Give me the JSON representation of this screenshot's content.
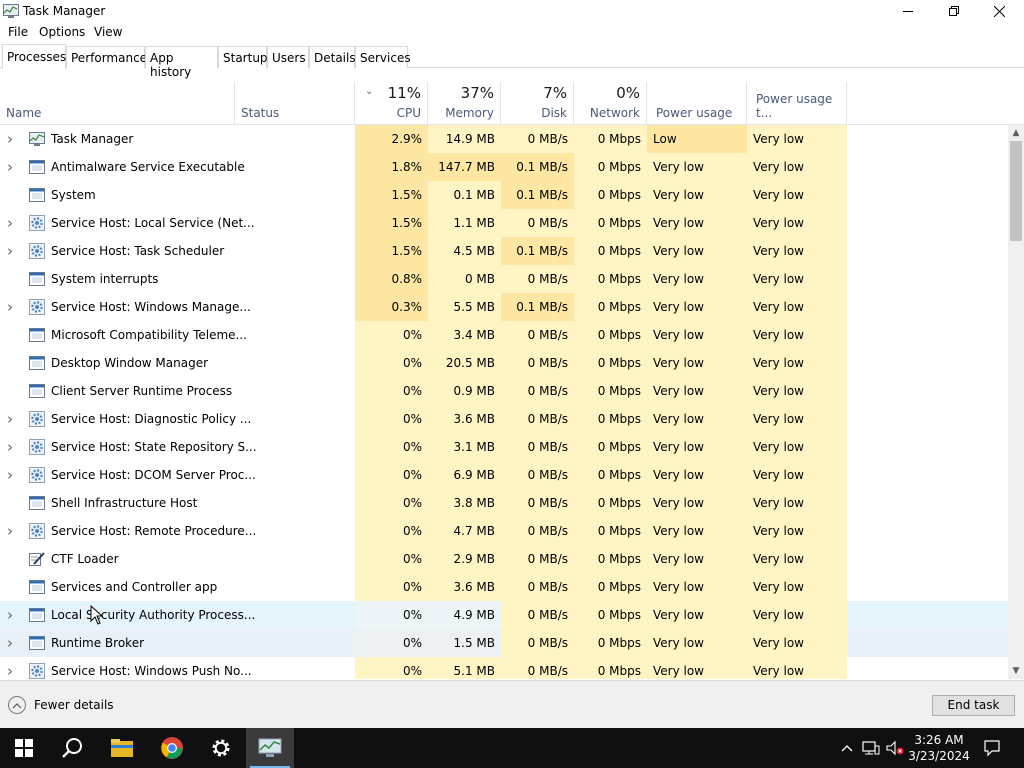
{
  "window": {
    "title": "Task Manager"
  },
  "menu": [
    "File",
    "Options",
    "View"
  ],
  "tabs": [
    "Processes",
    "Performance",
    "App history",
    "Startup",
    "Users",
    "Details",
    "Services"
  ],
  "columns": {
    "name": "Name",
    "status": "Status",
    "cpu": {
      "pct": "11%",
      "label": "CPU"
    },
    "memory": {
      "pct": "37%",
      "label": "Memory"
    },
    "disk": {
      "pct": "7%",
      "label": "Disk"
    },
    "network": {
      "pct": "0%",
      "label": "Network"
    },
    "power": "Power usage",
    "power_trend": "Power usage t..."
  },
  "processes": [
    {
      "name": "Task Manager",
      "expandable": true,
      "icon": "taskmgr-icon",
      "cpu": "2.9%",
      "memory": "14.9 MB",
      "disk": "0 MB/s",
      "network": "0 Mbps",
      "power": "Low",
      "power_trend": "Very low"
    },
    {
      "name": "Antimalware Service Executable",
      "expandable": true,
      "icon": "window-icon",
      "cpu": "1.8%",
      "memory": "147.7 MB",
      "disk": "0.1 MB/s",
      "network": "0 Mbps",
      "power": "Very low",
      "power_trend": "Very low"
    },
    {
      "name": "System",
      "expandable": false,
      "icon": "window-icon",
      "cpu": "1.5%",
      "memory": "0.1 MB",
      "disk": "0.1 MB/s",
      "network": "0 Mbps",
      "power": "Very low",
      "power_trend": "Very low"
    },
    {
      "name": "Service Host: Local Service (Net...",
      "expandable": true,
      "icon": "gear-icon",
      "cpu": "1.5%",
      "memory": "1.1 MB",
      "disk": "0 MB/s",
      "network": "0 Mbps",
      "power": "Very low",
      "power_trend": "Very low"
    },
    {
      "name": "Service Host: Task Scheduler",
      "expandable": true,
      "icon": "gear-icon",
      "cpu": "1.5%",
      "memory": "4.5 MB",
      "disk": "0.1 MB/s",
      "network": "0 Mbps",
      "power": "Very low",
      "power_trend": "Very low"
    },
    {
      "name": "System interrupts",
      "expandable": false,
      "icon": "window-icon",
      "cpu": "0.8%",
      "memory": "0 MB",
      "disk": "0 MB/s",
      "network": "0 Mbps",
      "power": "Very low",
      "power_trend": "Very low"
    },
    {
      "name": "Service Host: Windows Manage...",
      "expandable": true,
      "icon": "gear-icon",
      "cpu": "0.3%",
      "memory": "5.5 MB",
      "disk": "0.1 MB/s",
      "network": "0 Mbps",
      "power": "Very low",
      "power_trend": "Very low"
    },
    {
      "name": "Microsoft Compatibility Teleme...",
      "expandable": false,
      "icon": "window-icon",
      "cpu": "0%",
      "memory": "3.4 MB",
      "disk": "0 MB/s",
      "network": "0 Mbps",
      "power": "Very low",
      "power_trend": "Very low"
    },
    {
      "name": "Desktop Window Manager",
      "expandable": false,
      "icon": "window-icon",
      "cpu": "0%",
      "memory": "20.5 MB",
      "disk": "0 MB/s",
      "network": "0 Mbps",
      "power": "Very low",
      "power_trend": "Very low"
    },
    {
      "name": "Client Server Runtime Process",
      "expandable": false,
      "icon": "window-icon",
      "cpu": "0%",
      "memory": "0.9 MB",
      "disk": "0 MB/s",
      "network": "0 Mbps",
      "power": "Very low",
      "power_trend": "Very low"
    },
    {
      "name": "Service Host: Diagnostic Policy ...",
      "expandable": true,
      "icon": "gear-icon",
      "cpu": "0%",
      "memory": "3.6 MB",
      "disk": "0 MB/s",
      "network": "0 Mbps",
      "power": "Very low",
      "power_trend": "Very low"
    },
    {
      "name": "Service Host: State Repository S...",
      "expandable": true,
      "icon": "gear-icon",
      "cpu": "0%",
      "memory": "3.1 MB",
      "disk": "0 MB/s",
      "network": "0 Mbps",
      "power": "Very low",
      "power_trend": "Very low"
    },
    {
      "name": "Service Host: DCOM Server Proc...",
      "expandable": true,
      "icon": "gear-icon",
      "cpu": "0%",
      "memory": "6.9 MB",
      "disk": "0 MB/s",
      "network": "0 Mbps",
      "power": "Very low",
      "power_trend": "Very low"
    },
    {
      "name": "Shell Infrastructure Host",
      "expandable": false,
      "icon": "window-icon",
      "cpu": "0%",
      "memory": "3.8 MB",
      "disk": "0 MB/s",
      "network": "0 Mbps",
      "power": "Very low",
      "power_trend": "Very low"
    },
    {
      "name": "Service Host: Remote Procedure...",
      "expandable": true,
      "icon": "gear-icon",
      "cpu": "0%",
      "memory": "4.7 MB",
      "disk": "0 MB/s",
      "network": "0 Mbps",
      "power": "Very low",
      "power_trend": "Very low"
    },
    {
      "name": "CTF Loader",
      "expandable": false,
      "icon": "pen-icon",
      "cpu": "0%",
      "memory": "2.9 MB",
      "disk": "0 MB/s",
      "network": "0 Mbps",
      "power": "Very low",
      "power_trend": "Very low"
    },
    {
      "name": "Services and Controller app",
      "expandable": false,
      "icon": "window-icon",
      "cpu": "0%",
      "memory": "3.6 MB",
      "disk": "0 MB/s",
      "network": "0 Mbps",
      "power": "Very low",
      "power_trend": "Very low"
    },
    {
      "name": "Local Security Authority Process...",
      "expandable": true,
      "icon": "window-icon",
      "cpu": "0%",
      "memory": "4.9 MB",
      "disk": "0 MB/s",
      "network": "0 Mbps",
      "power": "Very low",
      "power_trend": "Very low"
    },
    {
      "name": "Runtime Broker",
      "expandable": true,
      "icon": "window-icon",
      "cpu": "0%",
      "memory": "1.5 MB",
      "disk": "0 MB/s",
      "network": "0 Mbps",
      "power": "Very low",
      "power_trend": "Very low"
    },
    {
      "name": "Service Host: Windows Push No...",
      "expandable": true,
      "icon": "gear-icon",
      "cpu": "0%",
      "memory": "5.1 MB",
      "disk": "0 MB/s",
      "network": "0 Mbps",
      "power": "Very low",
      "power_trend": "Very low"
    }
  ],
  "footer": {
    "fewer_details": "Fewer details",
    "end_task": "End task"
  },
  "taskbar": {
    "items": [
      "start-icon",
      "search-icon",
      "file-explorer-icon",
      "chrome-icon",
      "settings-icon",
      "taskmgr-icon"
    ],
    "clock_time": "3:26 AM",
    "clock_date": "3/23/2024"
  },
  "colors": {
    "heat_light": "#fff4c4",
    "heat_mid": "#fde7a3",
    "hover": "#e5f3fb",
    "taskbar": "#101010"
  }
}
